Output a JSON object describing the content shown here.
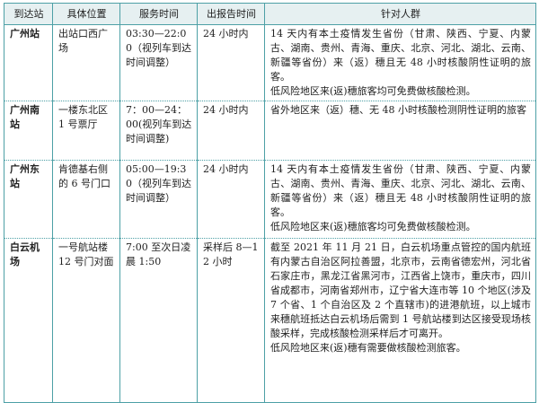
{
  "table": {
    "headers": [
      "到达站",
      "具体位置",
      "服务时间",
      "出报告时间",
      "针对人群"
    ],
    "rows": [
      {
        "station": "广州站",
        "location": "出站口西广场",
        "service_time": "03:30—22:00（视列车到达时间调整）",
        "report_time": "24 小时内",
        "target": [
          "14 天内有本土疫情发生省份（甘肃、陕西、宁夏、内蒙古、湖南、贵州、青海、重庆、北京、河北、湖北、云南、新疆等省份）来（返）穗且无 48 小时核酸阴性证明的旅客。",
          "低风险地区来(返)穗旅客均可免费做核酸检测。"
        ]
      },
      {
        "station": "广州南站",
        "location": "一楼东北区 1 号票厅",
        "service_time": "7：00—24：00(视列车到达时间调整)",
        "report_time": "24 小时内",
        "target": [
          "省外地区来（返）穗、无 48 小时核酸检测阴性证明的旅客"
        ]
      },
      {
        "station": "广州东站",
        "location": "肯德基右侧的 6 号门口",
        "service_time": "05:00—19:30（视列车到达时间调整）",
        "report_time": "24 小时内",
        "target": [
          "14 天内有本土疫情发生省份（甘肃、陕西、宁夏、内蒙古、湖南、贵州、青海、重庆、北京、河北、湖北、云南、新疆等省份）来（返）穗且无 48 小时核酸阴性证明的旅客。",
          "低风险地区来(返)穗旅客均可免费做核酸检测。"
        ]
      },
      {
        "station": "白云机场",
        "location": "一号航站楼 12 号门对面",
        "service_time": "7:00 至次日凌晨 1:50",
        "report_time": "采样后 8—12 小时",
        "target": [
          "截至 2021 年 11 月 21 日，白云机场重点管控的国内航班有内蒙古自治区阿拉善盟，北京市，云南省德宏州，河北省石家庄市，黑龙江省黑河市，江西省上饶市，重庆市，四川省成都市，河南省郑州市，辽宁省大连市等 10 个地区(涉及 7 个省、1 个自治区及 2 个直辖市)的进港航班，以上城市来穗航班抵达白云机场后需到 1 号航站楼到达区接受现场核酸采样，完成核酸检测采样后才可离开。",
          "低风险地区来(返)穗有需要做核酸检测旅客。"
        ]
      }
    ]
  }
}
